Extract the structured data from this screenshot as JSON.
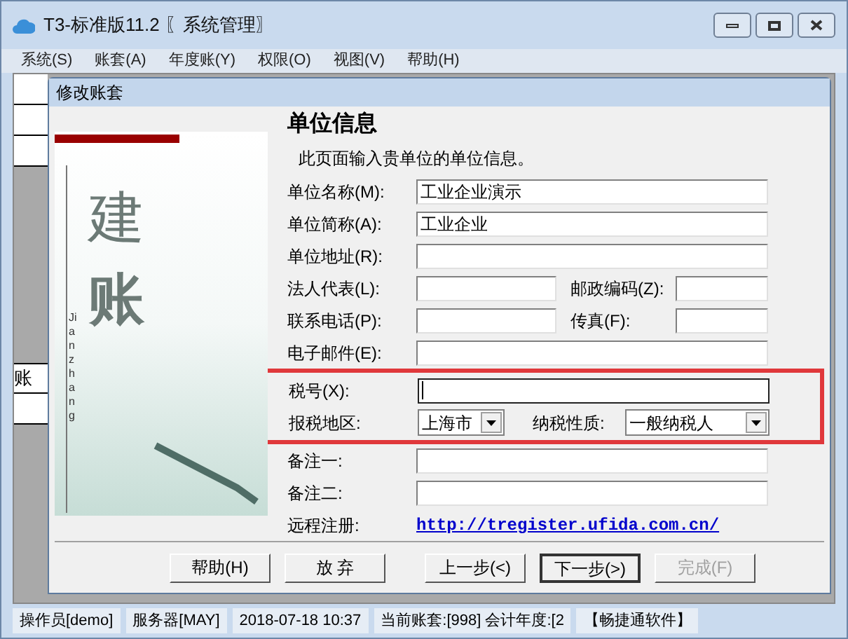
{
  "window": {
    "title": "T3-标准版11.2 〖系统管理〗"
  },
  "menu": [
    "系统(S)",
    "账套(A)",
    "年度账(Y)",
    "权限(O)",
    "视图(V)",
    "帮助(H)"
  ],
  "side_cells": [
    "",
    "",
    "",
    "账",
    ""
  ],
  "dialog": {
    "title": "修改账套",
    "art": {
      "big_chars": [
        "建",
        "账"
      ],
      "pinyin": "Jianzhang"
    },
    "heading": "单位信息",
    "intro": "此页面输入贵单位的单位信息。",
    "rows": [
      {
        "kind": "field",
        "highlighted": false,
        "label": "单位名称(M):",
        "value": "工业企业演示",
        "focused": false
      },
      {
        "kind": "field",
        "highlighted": false,
        "label": "单位简称(A):",
        "value": "工业企业",
        "focused": false
      },
      {
        "kind": "field",
        "highlighted": false,
        "label": "单位地址(R):",
        "value": "",
        "focused": false
      },
      {
        "kind": "pair",
        "highlighted": false,
        "label": "法人代表(L):",
        "value": "",
        "label2": "邮政编码(Z):",
        "value2": ""
      },
      {
        "kind": "pair",
        "highlighted": false,
        "label": "联系电话(P):",
        "value": "",
        "label2": "传真(F):",
        "value2": ""
      },
      {
        "kind": "field",
        "highlighted": false,
        "label": "电子邮件(E):",
        "value": "",
        "focused": false
      },
      {
        "kind": "field",
        "highlighted": true,
        "label": "税号(X):",
        "value": "",
        "focused": true
      },
      {
        "kind": "selects",
        "highlighted": true,
        "label": "报税地区:",
        "value": "上海市",
        "label2": "纳税性质:",
        "value2": "一般纳税人"
      },
      {
        "kind": "field",
        "highlighted": false,
        "label": "备注一:",
        "value": "",
        "focused": false
      },
      {
        "kind": "field",
        "highlighted": false,
        "label": "备注二:",
        "value": "",
        "focused": false
      },
      {
        "kind": "link",
        "highlighted": false,
        "label": "远程注册:",
        "value": "http://tregister.ufida.com.cn/"
      }
    ],
    "buttons": [
      {
        "label": "帮助(H)",
        "default": false,
        "disabled": false
      },
      {
        "label": "放 弃",
        "default": false,
        "disabled": false
      },
      {
        "label": "上一步(<)",
        "default": false,
        "disabled": false
      },
      {
        "label": "下一步(>)",
        "default": true,
        "disabled": false
      },
      {
        "label": "完成(F)",
        "default": false,
        "disabled": true
      }
    ]
  },
  "status_bar": [
    "操作员[demo]",
    "服务器[MAY]",
    "2018-07-18 10:37",
    "当前账套:[998] 会计年度:[2",
    "【畅捷通软件】"
  ]
}
